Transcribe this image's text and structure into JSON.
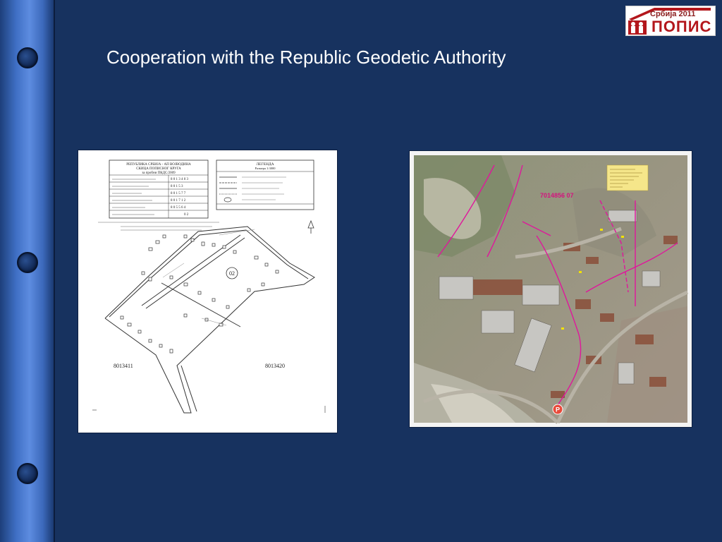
{
  "slide": {
    "title": "Cooperation with the Republic Geodetic Authority"
  },
  "logo": {
    "year_text": "Србија 2011",
    "word_text": "ПОПИС"
  },
  "map_sheet": {
    "header_line1": "РЕПУБЛИКА СРБИЈА - АП ВОЈВОДИНА",
    "header_line2": "СКИЦА ПОПИСНОГ КРУГА",
    "header_line3": "за пробни ПКДС/2009",
    "codes": [
      "8 0 1 3 4 0 3",
      "8 0 1 5 3",
      "8 0 1 5 7 7",
      "8 0 1 7 1 2",
      "8 0 5 5 6 4",
      "0 2"
    ],
    "legend_title": "ЛЕГЕНДА",
    "legend_scale": "Размера 1:3000",
    "circle_label": "02",
    "parcel_left": "8013411",
    "parcel_right": "8013420"
  },
  "aerial_map": {
    "parcel_code": "7014856 07",
    "marker_label": "P"
  }
}
